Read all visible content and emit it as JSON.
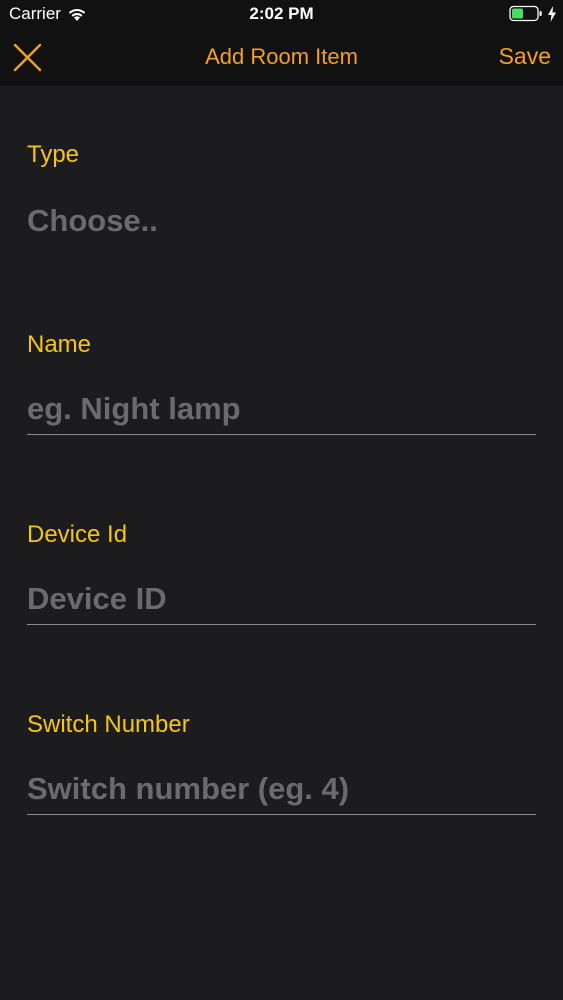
{
  "status_bar": {
    "carrier": "Carrier",
    "time": "2:02 PM",
    "wifi_icon": "wifi-icon",
    "battery_icon": "battery-icon",
    "charging_icon": "bolt-icon",
    "battery_color": "#4cd964"
  },
  "nav": {
    "close_icon": "close-icon",
    "title": "Add Room Item",
    "save_label": "Save",
    "accent_color": "#f2a027"
  },
  "form": {
    "type": {
      "label": "Type",
      "value": "Choose.."
    },
    "name": {
      "label": "Name",
      "placeholder": "eg. Night lamp",
      "value": ""
    },
    "device_id": {
      "label": "Device Id",
      "placeholder": "Device ID",
      "value": ""
    },
    "switch_number": {
      "label": "Switch Number",
      "placeholder": "Switch number (eg. 4)",
      "value": ""
    },
    "label_color": "#f5c518",
    "placeholder_color": "#6b6b6e"
  }
}
